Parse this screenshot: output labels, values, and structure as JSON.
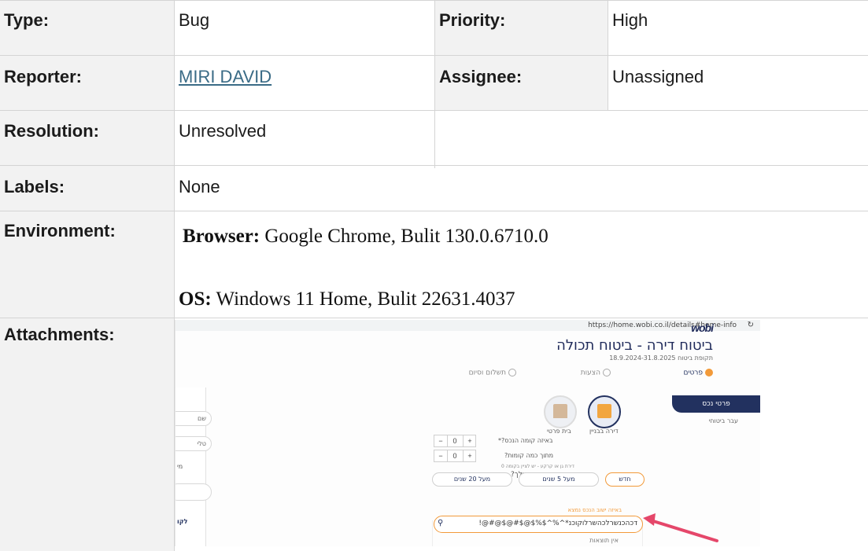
{
  "fields": {
    "type": {
      "label": "Type:",
      "value": "Bug"
    },
    "priority": {
      "label": "Priority:",
      "value": "High"
    },
    "reporter": {
      "label": "Reporter:",
      "value": "MIRI DAVID"
    },
    "assignee": {
      "label": "Assignee:",
      "value": "Unassigned"
    },
    "resolution": {
      "label": "Resolution:",
      "value": "Unresolved"
    },
    "labels": {
      "label": "Labels:",
      "value": "None"
    },
    "environment": {
      "label": "Environment:",
      "browser_label": "Browser:",
      "browser_value": " Google Chrome, Bulit 130.0.6710.0",
      "os_label": "OS:",
      "os_value": " Windows 11 Home, Bulit 22631.4037"
    },
    "attachments": {
      "label": "Attachments:"
    }
  },
  "attachment_screenshot": {
    "url": "https://home.wobi.co.il/details#home-info",
    "logo": "wobi",
    "title": "ביטוח דירה - ביטוח תכולה",
    "period": "תקופת ביטוח 18.9.2024-31.8.2025",
    "steps": [
      "פרטים",
      "הצעות",
      "תשלום וסיום"
    ],
    "tab_button": "פרטי נכס",
    "tab_sub": "עבר ביטוחי",
    "property_types": [
      "דירה בבניין",
      "בית פרטי"
    ],
    "floor_question": "באיזה קומה הנכס?*",
    "floor_value": "0",
    "floors_question": "מתוך כמה קומות?",
    "floors_value": "0",
    "age_note": "דירת גן או קרקע - יש לציין בקומה 0",
    "age_question": "בן כמה הנכס שלך?",
    "age_options": [
      "חדש",
      "מעל 5 שנים",
      "מעל 20 שנים"
    ],
    "search_label": "באיזה ישוב הנכס נמצא",
    "search_value": "!@#@$@#$@$%$^%^*דכהכנשרלכהשרלוקוכנ",
    "no_results": "אין תוצאות",
    "side_items": [
      "שם",
      "טלי",
      "מי",
      "לקו"
    ],
    "colors": {
      "navy": "#22315f",
      "orange": "#f29a3a",
      "arrow": "#e5476a"
    }
  }
}
